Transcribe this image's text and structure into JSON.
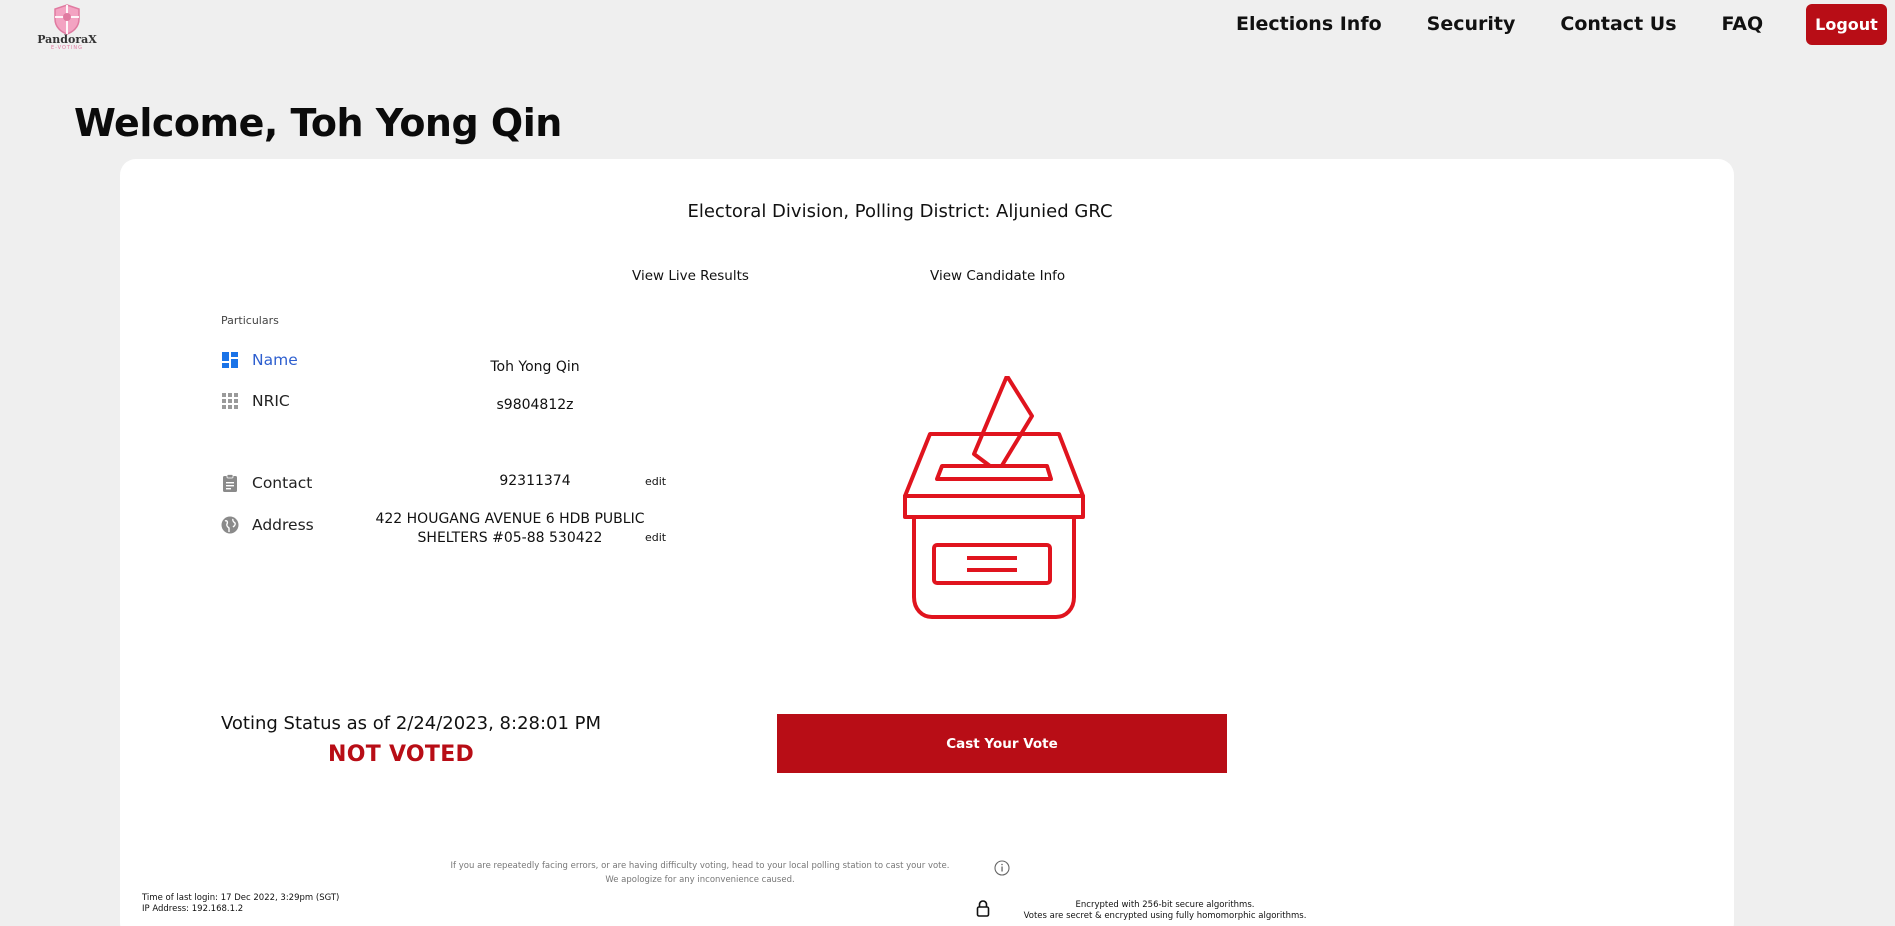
{
  "brand": {
    "name": "PandoraX",
    "tagline": "E-VOTING",
    "accent": "#b80d16",
    "logo_pink": "#e07aa0"
  },
  "nav": {
    "items": [
      {
        "label": "Elections Info"
      },
      {
        "label": "Security"
      },
      {
        "label": "Contact Us"
      },
      {
        "label": "FAQ"
      }
    ],
    "logout_label": "Logout"
  },
  "welcome": "Welcome, Toh Yong Qin",
  "card": {
    "division": "Electoral Division, Polling District: Aljunied GRC",
    "links": {
      "live_results": "View Live Results",
      "candidate_info": "View Candidate Info"
    },
    "particulars": {
      "heading": "Particulars",
      "name": {
        "label": "Name",
        "value": "Toh Yong Qin",
        "icon": "dashboard-icon"
      },
      "nric": {
        "label": "NRIC",
        "value": "s9804812z",
        "icon": "grid-icon"
      },
      "contact": {
        "label": "Contact",
        "value": "92311374",
        "icon": "clipboard-icon",
        "edit": "edit"
      },
      "address": {
        "label": "Address",
        "line1": "422 HOUGANG AVENUE 6 HDB PUBLIC",
        "line2": "SHELTERS #05-88 530422",
        "icon": "globe-icon",
        "edit": "edit"
      }
    },
    "voting": {
      "status_text": "Voting Status as of 2/24/2023, 8:28:01 PM",
      "status_value": "NOT VOTED",
      "cast_label": "Cast Your Vote"
    },
    "help": {
      "line1": "If you are repeatedly facing errors, or are having difficulty voting, head to your local polling station to cast your vote.",
      "line2": "We apologize for any inconvenience caused."
    },
    "session": {
      "last_login": "Time of last login: 17 Dec 2022, 3:29pm (SGT)",
      "ip": "IP Address: 192.168.1.2"
    },
    "security": {
      "line1": "Encrypted with 256-bit secure algorithms.",
      "line2": "Votes are secret & encrypted using fully homomorphic algorithms."
    }
  }
}
